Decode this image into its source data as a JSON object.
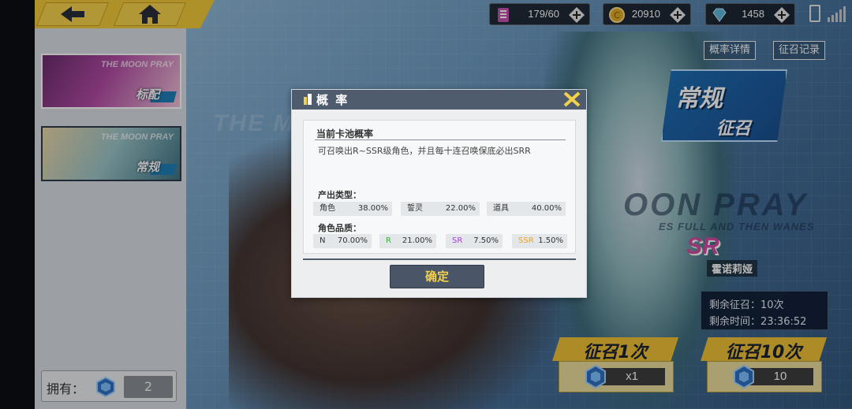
{
  "top_bar": {
    "resources": [
      {
        "icon": "stamina-icon",
        "value": "179/60",
        "color": "#c74fb0"
      },
      {
        "icon": "gold-coin-icon",
        "value": "20910",
        "color": "#e0a928"
      },
      {
        "icon": "diamond-icon",
        "value": "1458",
        "color": "#5fb6d9"
      }
    ]
  },
  "left_panel": {
    "banners": [
      {
        "title": "THE MOON PRAY",
        "label": "标配"
      },
      {
        "title": "THE MOON PRAY",
        "label": "常规"
      }
    ],
    "owned": {
      "label": "拥有：",
      "value": "2"
    }
  },
  "background": {
    "title_left": "THE M",
    "title_right": "OON PRAY",
    "subtitle_right": "ES FULL AND THEN WANES"
  },
  "right_panel": {
    "detail_button": "概率详情",
    "record_button": "征召记录",
    "badge_line1": "常规",
    "badge_line2": "征召",
    "featured_rarity": "SR",
    "featured_name": "霍诺莉娅",
    "remaining_summons": "剩余征召：10次",
    "remaining_time": "剩余时间：23:36:52",
    "summon_once": {
      "label": "征召1次",
      "cost": "x1"
    },
    "summon_ten": {
      "label": "征召10次",
      "cost": "10"
    }
  },
  "dialog": {
    "title": "概 率",
    "card_heading": "当前卡池概率",
    "description": "可召唤出R~SSR级角色，并且每十连召唤保底必出SRR",
    "type_section_label": "产出类型：",
    "types": [
      {
        "name": "角色",
        "rate": "38.00%"
      },
      {
        "name": "誓灵",
        "rate": "22.00%"
      },
      {
        "name": "道具",
        "rate": "40.00%"
      }
    ],
    "quality_section_label": "角色品质：",
    "qualities": [
      {
        "name": "N",
        "rate": "70.00%",
        "color": "#333333"
      },
      {
        "name": "R",
        "rate": "21.00%",
        "color": "#3fa63f"
      },
      {
        "name": "SR",
        "rate": "7.50%",
        "color": "#a23fd0"
      },
      {
        "name": "SSR",
        "rate": "1.50%",
        "color": "#e8a22a"
      }
    ],
    "confirm_button": "确定"
  },
  "colors": {
    "accent_yellow": "#f1c93a",
    "dialog_header": "#4f5c6e",
    "confirm_text": "#f2d24a"
  }
}
